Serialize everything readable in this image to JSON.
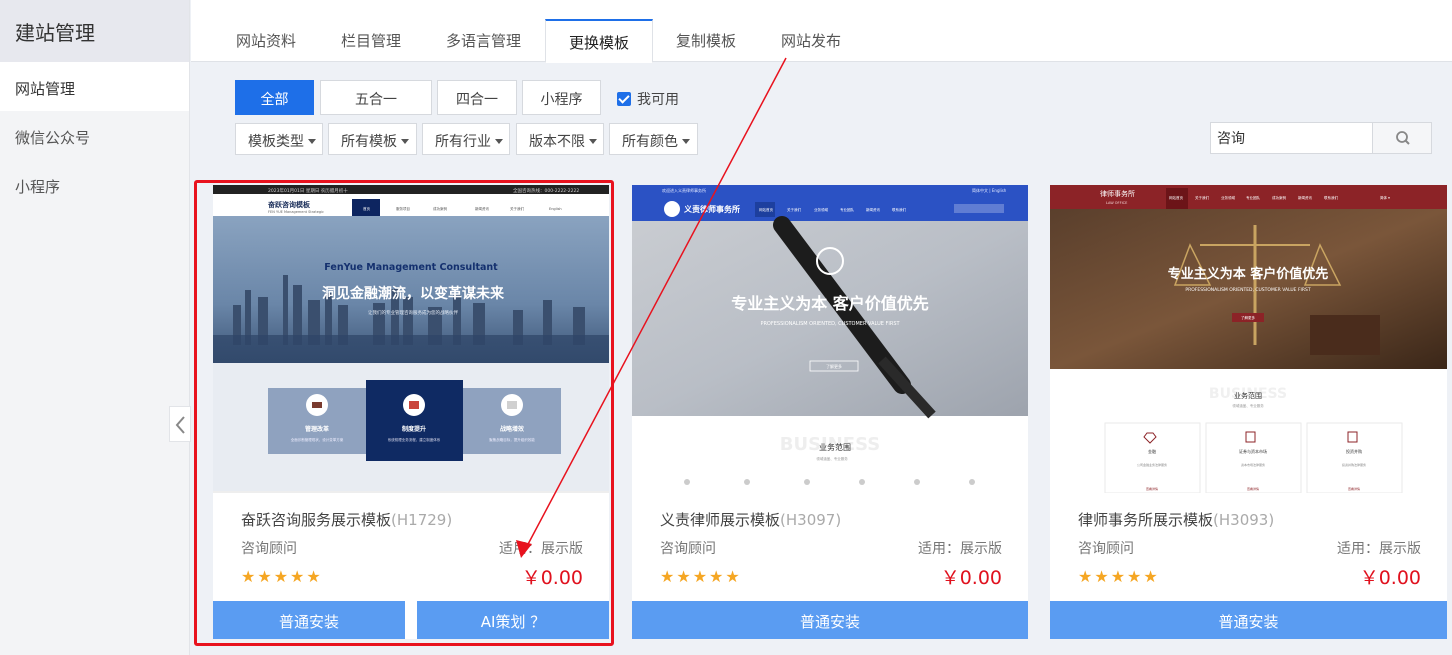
{
  "sidebar": {
    "title": "建站管理",
    "items": [
      {
        "label": "网站管理"
      },
      {
        "label": "微信公众号"
      },
      {
        "label": "小程序"
      }
    ]
  },
  "tabs": [
    {
      "label": "网站资料"
    },
    {
      "label": "栏目管理"
    },
    {
      "label": "多语言管理"
    },
    {
      "label": "更换模板"
    },
    {
      "label": "复制模板"
    },
    {
      "label": "网站发布"
    }
  ],
  "filters": {
    "type_buttons": [
      {
        "label": "全部"
      },
      {
        "label": "五合一"
      },
      {
        "label": "四合一"
      },
      {
        "label": "小程序"
      }
    ],
    "available_label": "我可用",
    "dropdowns": [
      {
        "label": "模板类型"
      },
      {
        "label": "所有模板"
      },
      {
        "label": "所有行业"
      },
      {
        "label": "版本不限"
      },
      {
        "label": "所有颜色"
      }
    ],
    "search_value": "咨询"
  },
  "cards": [
    {
      "name": "奋跃咨询服务展示模板",
      "code": "(H1729)",
      "category": "咨询顾问",
      "fit": "适用：展示版",
      "price": "￥0.00",
      "rating": "★★★★★",
      "install_label": "普通安装",
      "ai_label": "AI策划 ？",
      "thumb": {
        "top_bar": "2023年01月01日 星期日  农历腊月初十",
        "top_phone": "全国咨询热线：000-2222-2222",
        "logo": "奋跃咨询模板",
        "logo_en": "FEN YUE Management Strategic",
        "nav": [
          "首页",
          "服务项目",
          "成功案例",
          "新闻资讯",
          "关于我们",
          "English"
        ],
        "heading_en": "FenYue Management Consultant",
        "heading": "洞见金融潮流，以变革谋未来",
        "sub": "让我们的专业管理咨询服务成为您的战略伙伴",
        "boxes": [
          {
            "title": "管理改革",
            "text": "全面诊断管理现状，设计变革方案"
          },
          {
            "title": "制度提升",
            "text": "系统梳理业务流程，建立制度体系"
          },
          {
            "title": "战略增效",
            "text": "聚焦战略目标，提升组织效能"
          }
        ]
      }
    },
    {
      "name": "义责律师展示模板",
      "code": "(H3097)",
      "category": "咨询顾问",
      "fit": "适用：展示版",
      "price": "￥0.00",
      "rating": "★★★★★",
      "install_label": "普通安装",
      "thumb": {
        "top_left": "欢迎进入义责律师事务所",
        "top_right": "简体中文 | English",
        "logo": "义责律师事务所",
        "nav": [
          "网站首页",
          "关于我们",
          "业务领域",
          "专业团队",
          "新闻资讯",
          "联系我们"
        ],
        "heading": "专业主义为本 客户价值优先",
        "heading_en": "PROFESSIONALISM ORIENTED, CUSTOMER VALUE FIRST",
        "more": "了解更多",
        "section_bg": "BUSINESS",
        "section": "业务范围",
        "section_sub": "领域涵盖、专业服务"
      }
    },
    {
      "name": "律师事务所展示模板",
      "code": "(H3093)",
      "category": "咨询顾问",
      "fit": "适用：展示版",
      "price": "￥0.00",
      "rating": "★★★★★",
      "install_label": "普通安装",
      "thumb": {
        "logo": "律师事务所",
        "logo_en": "LAW OFFICE",
        "nav": [
          "网站首页",
          "关于我们",
          "业务领域",
          "专业团队",
          "成功案例",
          "新闻资讯",
          "联系我们"
        ],
        "lang": "简体 ▾",
        "heading": "专业主义为本 客户价值优先",
        "heading_en": "PROFESSIONALISM ORIENTED, CUSTOMER VALUE FIRST",
        "more": "了解更多",
        "section_bg": "BUSINESS",
        "section": "业务范围",
        "section_sub": "领域涵盖、专业服务",
        "boxes": [
          {
            "title": "金融",
            "text": "公司金融业务法律服务",
            "link": "查看详情"
          },
          {
            "title": "证券与资本市场",
            "text": "资本市场法律服务",
            "link": "查看详情"
          },
          {
            "title": "投资并购",
            "text": "投资并购法律服务",
            "link": "查看详情"
          }
        ]
      }
    }
  ],
  "colors": {
    "accent": "#1e6fe8",
    "install_button": "#5a9cf2",
    "price": "#e0111e",
    "star": "#f5a623",
    "highlight": "#e8121e"
  }
}
